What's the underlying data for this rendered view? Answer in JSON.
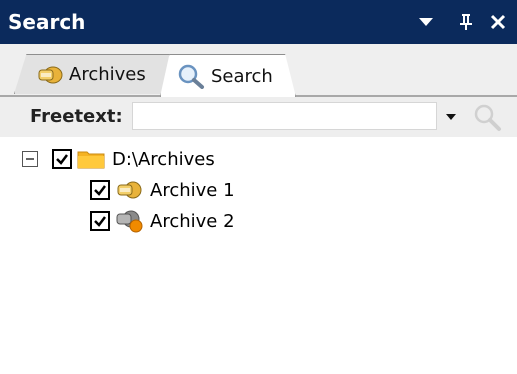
{
  "panel": {
    "title": "Search",
    "buttons": [
      "menu-dropdown-icon",
      "pin-icon",
      "close-icon"
    ]
  },
  "tabs": [
    {
      "label": "Archives",
      "icon": "archive-icon",
      "selected": false
    },
    {
      "label": "Search",
      "icon": "magnifier-icon",
      "selected": true
    }
  ],
  "freetext": {
    "label": "Freetext:",
    "value": "",
    "placeholder": ""
  },
  "tree": {
    "root": {
      "label": "D:\\Archives",
      "checked": true,
      "expanded": true,
      "icon": "folder-icon"
    },
    "children": [
      {
        "label": "Archive 1",
        "checked": true,
        "icon": "archive-icon"
      },
      {
        "label": "Archive 2",
        "checked": true,
        "icon": "archive-warning-icon"
      }
    ]
  },
  "colors": {
    "titlebar_bg": "#0b2a5c",
    "tabstrip_bg": "#efefef",
    "folder": "#f5b323",
    "archive": "#e8b23a",
    "warning": "#f08a00"
  }
}
